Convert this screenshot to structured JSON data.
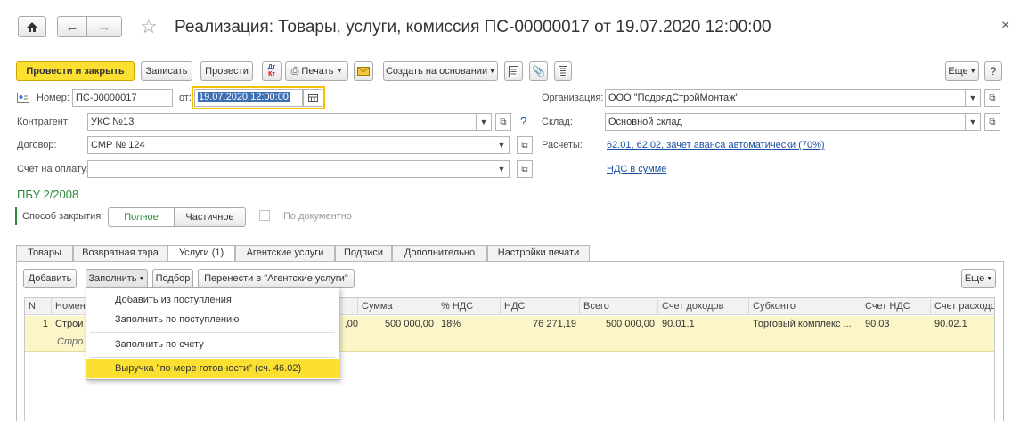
{
  "header": {
    "title": "Реализация: Товары, услуги, комиссия ПС-00000017 от 19.07.2020 12:00:00",
    "close": "×"
  },
  "toolbar": {
    "post_close": "Провести и закрыть",
    "save": "Записать",
    "post": "Провести",
    "dt_kt_top": "Дт",
    "dt_kt_bottom": "Кт",
    "print": "Печать",
    "create_based": "Создать на основании",
    "more": "Еще"
  },
  "form": {
    "number_label": "Номер:",
    "number_value": "ПС-00000017",
    "date_label": "от:",
    "date_value": "19.07.2020 12:00:00",
    "counterparty_label": "Контрагент:",
    "counterparty_value": "УКС №13",
    "help_mark": "?",
    "contract_label": "Договор:",
    "contract_value": "СМР № 124",
    "invoice_label": "Счет на оплату:",
    "invoice_value": "",
    "org_label": "Организация:",
    "org_value": "ООО \"ПодрядСтройМонтаж\"",
    "warehouse_label": "Склад:",
    "warehouse_value": "Основной склад",
    "settlements_label": "Расчеты:",
    "settlements_link": "62.01, 62.02, зачет аванса автоматически (70%)",
    "vat_link": "НДС в сумме",
    "pbu": "ПБУ 2/2008",
    "closing_label": "Способ закрытия:",
    "closing_full": "Полное",
    "closing_partial": "Частичное",
    "by_document": "По документно"
  },
  "tabs": [
    {
      "label": "Товары"
    },
    {
      "label": "Возвратная тара"
    },
    {
      "label": "Услуги (1)"
    },
    {
      "label": "Агентские услуги"
    },
    {
      "label": "Подписи"
    },
    {
      "label": "Дополнительно"
    },
    {
      "label": "Настройки печати"
    }
  ],
  "table_toolbar": {
    "add": "Добавить",
    "fill": "Заполнить",
    "select": "Подбор",
    "move": "Перенести в \"Агентские услуги\"",
    "more": "Еще"
  },
  "columns": {
    "n": "N",
    "name": "Номен",
    "sum": "Сумма",
    "vat_rate": "% НДС",
    "vat": "НДС",
    "total": "Всего",
    "income_acc": "Счет доходов",
    "subconto": "Субконто",
    "vat_acc": "Счет НДС",
    "expense_acc": "Счет расходо"
  },
  "row": {
    "n": "1",
    "name": "Строи",
    "name_sub": "Стро",
    "price_tail": ",00",
    "sum": "500 000,00",
    "vat_rate": "18%",
    "vat": "76 271,19",
    "total": "500 000,00",
    "income_acc": "90.01.1",
    "subconto": "Торговый комплекс ...",
    "vat_acc": "90.03",
    "expense_acc": "90.02.1"
  },
  "fill_menu": [
    {
      "label": "Добавить из поступления"
    },
    {
      "label": "Заполнить по поступлению"
    },
    {
      "label": "Заполнить по счету"
    },
    {
      "label": "Выручка \"по мере готовности\" (сч. 46.02)"
    }
  ],
  "colors": {
    "accent_yellow": "#fbe032",
    "highlight_row": "#fbf5c8",
    "link": "#1a4fa3",
    "green": "#2e8b3a"
  }
}
